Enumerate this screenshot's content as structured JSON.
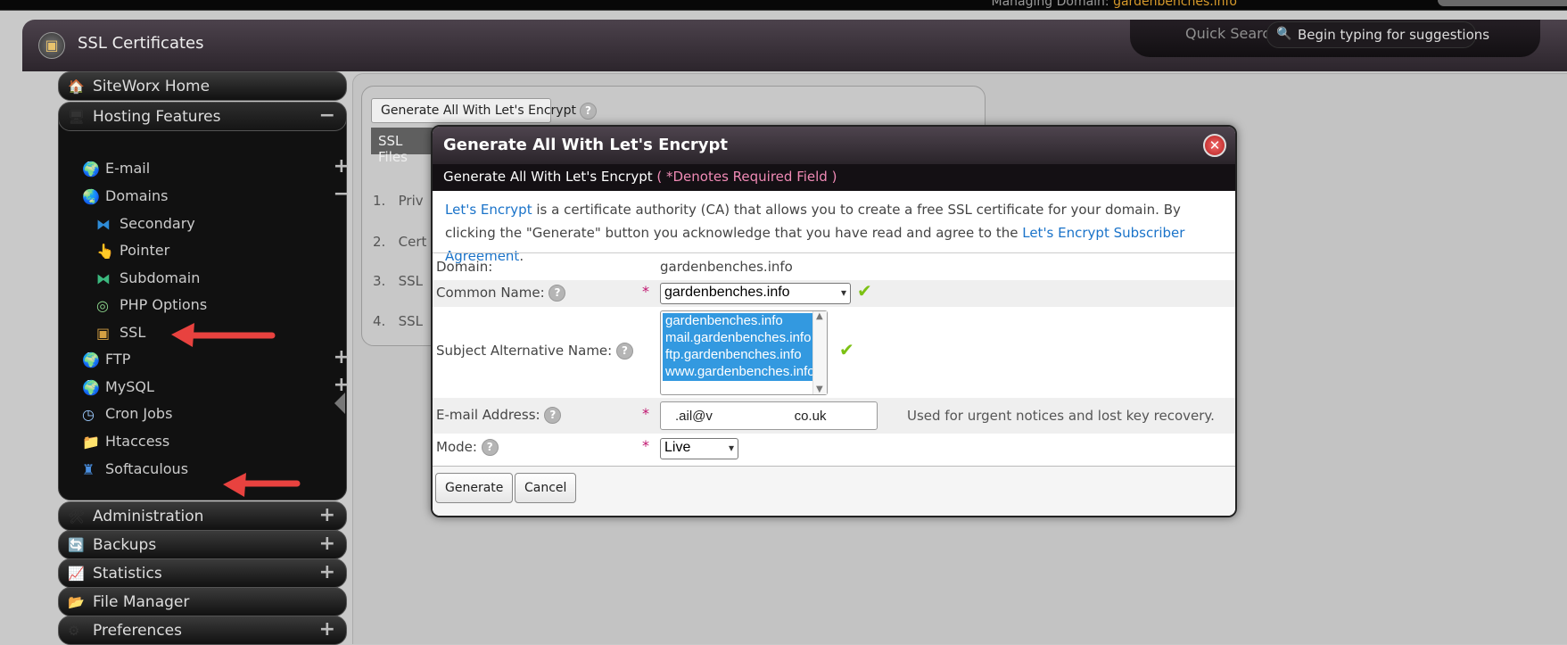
{
  "topbar": {
    "managing_label": "Managing Domain:",
    "managing_domain": "gardenbenches.info"
  },
  "header": {
    "title": "SSL Certificates",
    "quick_search_label": "Quick Search",
    "search_placeholder": "Begin typing for suggestions"
  },
  "sidebar": {
    "siteworx_home": "SiteWorx Home",
    "hosting_features": "Hosting Features",
    "items": [
      {
        "label": "E-mail",
        "icon": "email-globe-icon",
        "toggle": "+"
      },
      {
        "label": "Domains",
        "icon": "globe-icon",
        "toggle": "−"
      },
      {
        "label": "Secondary",
        "icon": "secondary-domain-icon"
      },
      {
        "label": "Pointer",
        "icon": "pointer-domain-icon"
      },
      {
        "label": "Subdomain",
        "icon": "subdomain-icon"
      },
      {
        "label": "PHP Options",
        "icon": "php-icon"
      },
      {
        "label": "SSL",
        "icon": "certificate-icon"
      },
      {
        "label": "FTP",
        "icon": "ftp-globe-icon",
        "toggle": "+"
      },
      {
        "label": "MySQL",
        "icon": "mysql-globe-icon",
        "toggle": "+"
      },
      {
        "label": "Cron Jobs",
        "icon": "clock-icon"
      },
      {
        "label": "Htaccess",
        "icon": "folder-icon"
      },
      {
        "label": "Softaculous",
        "icon": "softaculous-icon"
      }
    ],
    "hosting_toggle": "−",
    "groups": [
      {
        "label": "Administration",
        "toggle": "+"
      },
      {
        "label": "Backups",
        "toggle": "+"
      },
      {
        "label": "Statistics",
        "toggle": "+"
      },
      {
        "label": "File Manager"
      },
      {
        "label": "Preferences",
        "toggle": "+"
      }
    ]
  },
  "main": {
    "tab_label": "Generate All With Let's Encrypt",
    "ssl_files_header": "SSL Files",
    "rows": [
      {
        "num": "1.",
        "text": "Priv"
      },
      {
        "num": "2.",
        "text": "Cert"
      },
      {
        "num": "3.",
        "text": "SSL"
      },
      {
        "num": "4.",
        "text": "SSL"
      }
    ]
  },
  "modal": {
    "title": "Generate All With Let's Encrypt",
    "subtitle": "Generate All With Let's Encrypt",
    "required_note": "( *Denotes Required Field )",
    "intro_link": "Let's Encrypt",
    "intro_text_1": " is a certificate authority (CA) that allows you to create a free SSL certificate for your domain. By clicking the \"Generate\" button you acknowledge that you have read and agree to the ",
    "intro_agreement_link": "Let's Encrypt Subscriber Agreement",
    "intro_text_2": ".",
    "fields": {
      "domain_label": "Domain:",
      "domain_value": "gardenbenches.info",
      "common_name_label": "Common Name:",
      "common_name_value": "gardenbenches.info",
      "san_label": "Subject Alternative Name:",
      "san_options": [
        "gardenbenches.info",
        "mail.gardenbenches.info",
        "ftp.gardenbenches.info",
        "www.gardenbenches.info"
      ],
      "email_label": "E-mail Address:",
      "email_value": ".ail@v                      co.uk",
      "email_hint": "Used for urgent notices and lost key recovery.",
      "mode_label": "Mode:",
      "mode_value": "Live",
      "required_star": "*"
    },
    "buttons": {
      "generate": "Generate",
      "cancel": "Cancel"
    }
  },
  "colors": {
    "accent_link": "#1a73c9",
    "required": "#c0156f",
    "arrow": "#e8423f",
    "check": "#7cc114",
    "selection": "#3399e0"
  }
}
